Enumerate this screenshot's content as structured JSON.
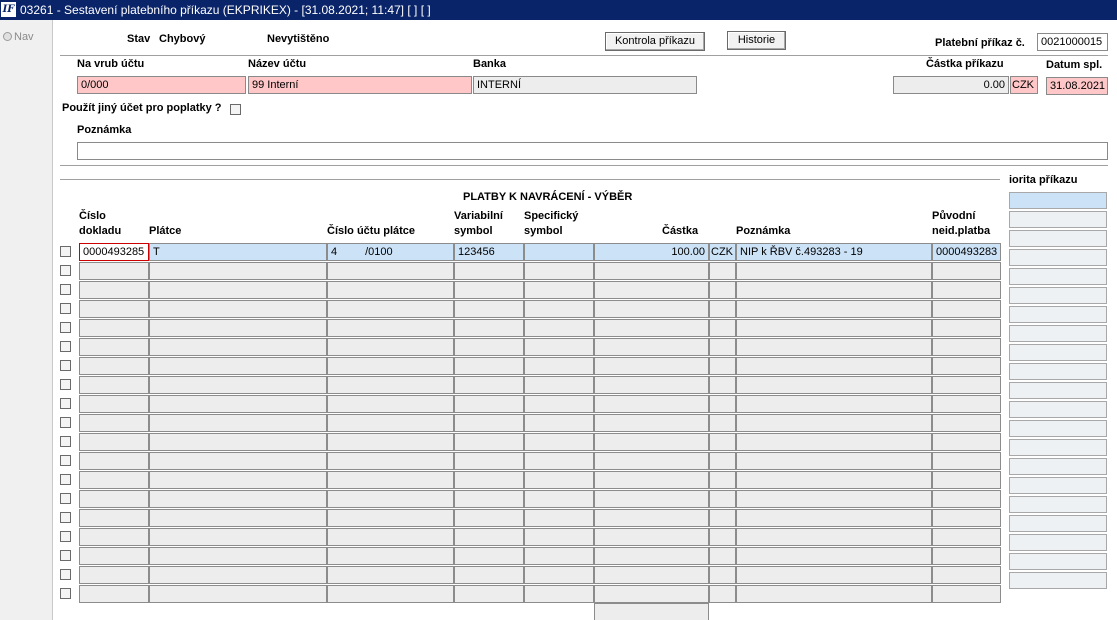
{
  "window": {
    "title": "03261 - Sestavení platebního příkazu (EKPRIKEX) - [31.08.2021; 11:47]  [ ]  [ ]",
    "logo": "IF"
  },
  "nav": {
    "label": "Nav"
  },
  "header": {
    "stav_label": "Stav",
    "stav_value": "Chybový",
    "tisk_status": "Nevytištěno",
    "kontrola_button": "Kontrola příkazu",
    "historie_button": "Historie",
    "prikaz_label": "Platební příkaz č.",
    "prikaz_value": "0021000015"
  },
  "account": {
    "na_vrub_label": "Na vrub účtu",
    "na_vrub_value": "0/000",
    "nazev_label": "Název účtu",
    "nazev_value": "99 Interní",
    "banka_label": "Banka",
    "banka_value": "INTERNÍ",
    "castka_label": "Částka příkazu",
    "castka_value": "0.00",
    "mena_value": "CZK",
    "datum_label": "Datum spl.",
    "datum_value": "31.08.2021"
  },
  "fees": {
    "label": "Použít jiný účet pro poplatky ?"
  },
  "note": {
    "label": "Poznámka",
    "value": ""
  },
  "payments": {
    "title": "PLATBY K NAVRÁCENÍ - VÝBĚR",
    "priorita_header": "iorita příkazu",
    "headers": {
      "cislo_dokladu": [
        "Číslo",
        "dokladu"
      ],
      "platce": "Plátce",
      "cislo_uctu": "Číslo účtu plátce",
      "variabilni": [
        "Variabilní",
        "symbol"
      ],
      "specificky": [
        "Specifický",
        "symbol"
      ],
      "castka": "Částka",
      "poznamka": "Poznámka",
      "puvodni": [
        "Původní",
        "neid.platba"
      ]
    },
    "rows": [
      {
        "cislo_dokladu": "0000493285",
        "platce": "T",
        "ucet_cislo": "4",
        "ucet_banka": "/0100",
        "variabilni": "123456",
        "specificky": "",
        "castka": "100.00",
        "mena": "CZK",
        "poznamka": "NIP k ŘBV č.493283 - 19",
        "puvodni": "0000493283"
      }
    ],
    "empty_row_count": 18
  }
}
